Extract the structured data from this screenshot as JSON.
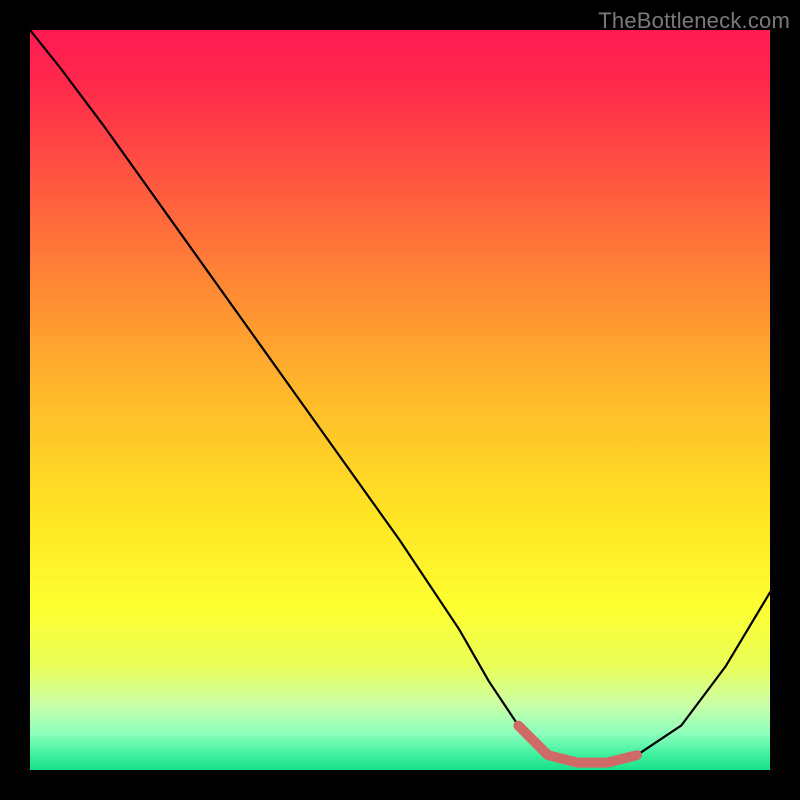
{
  "watermark": "TheBottleneck.com",
  "chart_data": {
    "type": "line",
    "title": "",
    "xlabel": "",
    "ylabel": "",
    "xlim": [
      0,
      100
    ],
    "ylim": [
      0,
      100
    ],
    "series": [
      {
        "name": "curve",
        "x": [
          0,
          4,
          10,
          20,
          30,
          40,
          50,
          58,
          62,
          66,
          70,
          74,
          78,
          82,
          88,
          94,
          100
        ],
        "values": [
          100,
          95,
          87,
          73,
          59,
          45,
          31,
          19,
          12,
          6,
          2,
          1,
          1,
          2,
          6,
          14,
          24
        ]
      }
    ],
    "highlight": {
      "name": "basin",
      "color": "#cf6a67",
      "x": [
        66,
        70,
        74,
        78,
        82
      ],
      "values": [
        6,
        2,
        1,
        1,
        2
      ]
    },
    "gradient_stops": [
      {
        "offset": 0.0,
        "color": "#ff1a52"
      },
      {
        "offset": 0.08,
        "color": "#ff2b4b"
      },
      {
        "offset": 0.2,
        "color": "#ff5540"
      },
      {
        "offset": 0.35,
        "color": "#ff8a34"
      },
      {
        "offset": 0.5,
        "color": "#ffbb2a"
      },
      {
        "offset": 0.65,
        "color": "#ffe324"
      },
      {
        "offset": 0.78,
        "color": "#fdff30"
      },
      {
        "offset": 0.86,
        "color": "#eaff5a"
      },
      {
        "offset": 0.91,
        "color": "#ccffa5"
      },
      {
        "offset": 0.95,
        "color": "#8effbd"
      },
      {
        "offset": 0.98,
        "color": "#3df09e"
      },
      {
        "offset": 1.0,
        "color": "#18e08a"
      }
    ]
  }
}
